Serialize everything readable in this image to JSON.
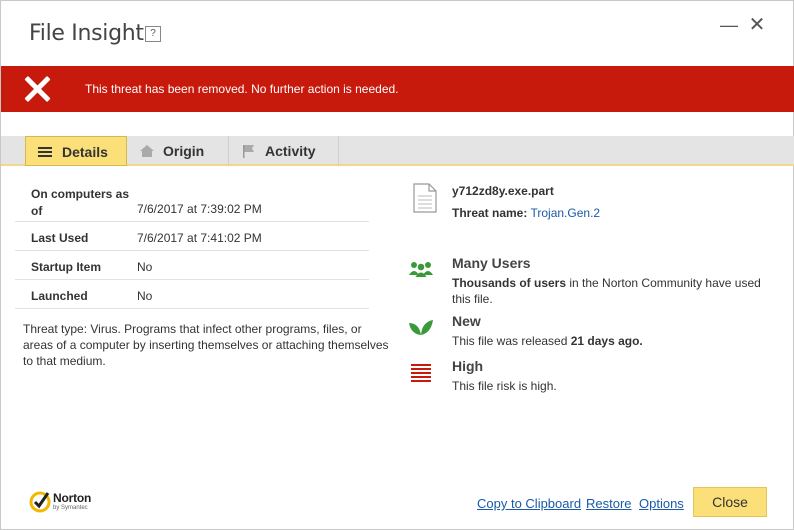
{
  "window": {
    "title": "File Insight",
    "help_label": "?",
    "minimize_label": "—",
    "close_label": "✕"
  },
  "banner": {
    "message": "This threat has been removed. No further action is needed.",
    "color": "#c8190d"
  },
  "tabs": [
    {
      "label": "Details",
      "active": true
    },
    {
      "label": "Origin",
      "active": false
    },
    {
      "label": "Activity",
      "active": false
    }
  ],
  "details": {
    "rows": [
      {
        "key_line1": "On computers as",
        "key_line2": "of",
        "value": "7/6/2017 at 7:39:02 PM"
      },
      {
        "key": "Last Used",
        "value": "7/6/2017 at 7:41:02 PM"
      },
      {
        "key": "Startup Item",
        "value": "No"
      },
      {
        "key": "Launched",
        "value": "No"
      }
    ],
    "threat_description": "Threat type: Virus. Programs that infect other programs, files, or areas of a computer by inserting themselves or attaching themselves to that medium."
  },
  "file": {
    "name": "y712zd8y.exe.part",
    "threat_label": "Threat name:",
    "threat_name": "Trojan.Gen.2"
  },
  "insights": {
    "users": {
      "heading": "Many Users",
      "desc_bold": "Thousands of users",
      "desc_rest": " in the Norton Community have used this file.",
      "icon": "users-icon"
    },
    "age": {
      "heading": "New",
      "desc_pre": "This file was released ",
      "desc_bold": "21 days ago.",
      "icon": "leaf-icon"
    },
    "risk": {
      "heading": "High",
      "desc": "This file risk is high.",
      "icon": "risk-bars-icon"
    }
  },
  "footer": {
    "logo_text": "Norton",
    "logo_sub": "by Symantec",
    "copy_label": "Copy to Clipboard",
    "restore_label": "Restore",
    "options_label": "Options",
    "close_label": "Close"
  },
  "colors": {
    "accent": "#fbe07a",
    "link": "#1a5aa8",
    "green": "#3a9a3a",
    "risk": "#c8190d"
  }
}
